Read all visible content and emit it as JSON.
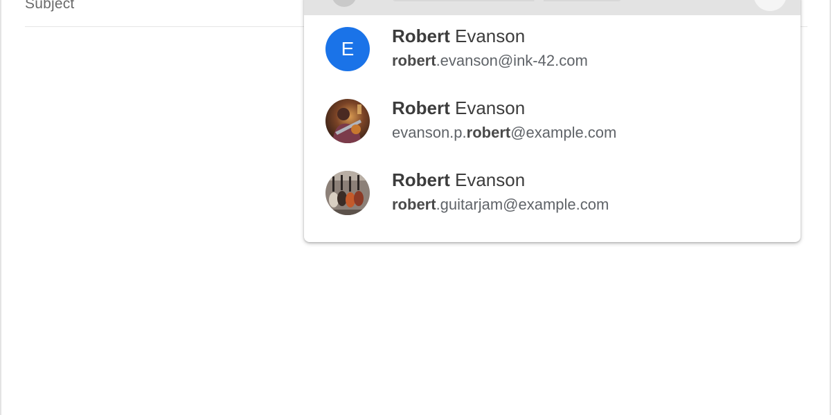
{
  "form": {
    "subject_label": "Subject"
  },
  "suggestions": [
    {
      "avatar_type": "letter",
      "avatar_letter": "E",
      "avatar_color": "#1a73e8",
      "name_bold": "Robert",
      "name_rest": " Evanson",
      "email_pre": "",
      "email_bold": "robert",
      "email_post": ".evanson@ink-42.com"
    },
    {
      "avatar_type": "photo",
      "avatar_icon": "person-guitar-photo",
      "name_bold": "Robert",
      "name_rest": " Evanson",
      "email_pre": "evanson.p.",
      "email_bold": "robert",
      "email_post": "@example.com"
    },
    {
      "avatar_type": "photo",
      "avatar_icon": "guitars-photo",
      "name_bold": "Robert",
      "name_rest": " Evanson",
      "email_pre": "",
      "email_bold": "robert",
      "email_post": ".guitarjam@example.com"
    }
  ]
}
